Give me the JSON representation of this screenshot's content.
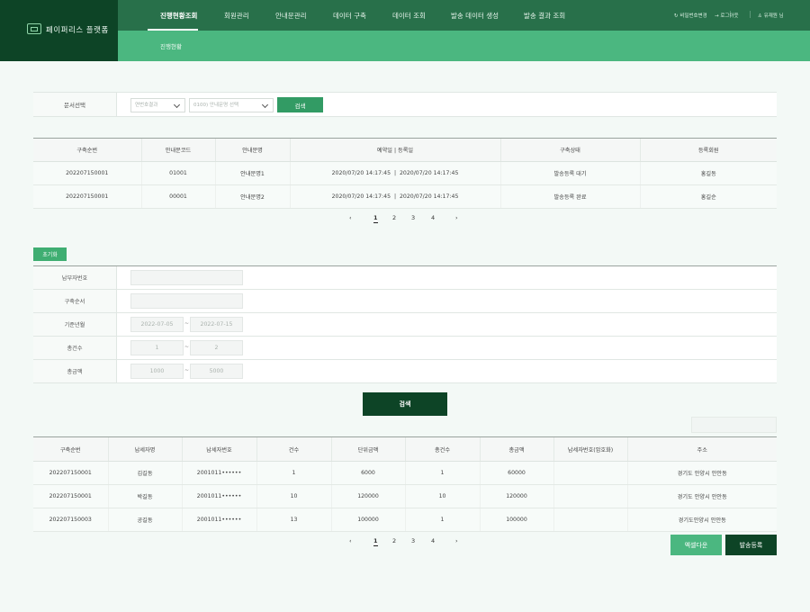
{
  "header": {
    "logo_text": "페이퍼리스 플랫폼",
    "nav": [
      "진행현황조회",
      "회원관리",
      "안내문관리",
      "데이터 구축",
      "데이터 조회",
      "발송 데이터 생성",
      "발송 결과 조회"
    ],
    "active_nav": "진행현황조회",
    "utils": {
      "password_change": "비밀번호변경",
      "logout": "로그아웃",
      "user": "유재원 님"
    },
    "subnav": "진행현황"
  },
  "filter": {
    "label": "문서선택",
    "select1_placeholder": "연번호결과",
    "select2_placeholder": "0100) 안내문명 선택",
    "search_label": "검색"
  },
  "table1": {
    "headers": [
      "구축순번",
      "안내문코드",
      "안내문명",
      "예약일 | 등록일",
      "구축상태",
      "등록회원"
    ],
    "rows": [
      [
        "202207150001",
        "01001",
        "안내문명1",
        "2020/07/20 14:17:45  |  2020/07/20 14:17:45",
        "발송등록 대기",
        "홍길동"
      ],
      [
        "202207150001",
        "00001",
        "안내문명2",
        "2020/07/20 14:17:45  |  2020/07/20 14:17:45",
        "발송등록 완료",
        "홍길순"
      ]
    ]
  },
  "pagination": {
    "prev": "‹",
    "next": "›",
    "pages": [
      "1",
      "2",
      "3",
      "4"
    ],
    "current": "1"
  },
  "search_form": {
    "reset_label": "초기화",
    "fields": [
      {
        "label": "납부자번호",
        "value": ""
      },
      {
        "label": "구축순서",
        "value": ""
      },
      {
        "label": "기준년월",
        "from": "2022-07-05",
        "to": "2022-07-15"
      },
      {
        "label": "총건수",
        "from": "1",
        "to": "2"
      },
      {
        "label": "총금액",
        "from": "1000",
        "to": "5000"
      }
    ],
    "range_sep": "~",
    "search_label": "검색"
  },
  "table2": {
    "headers": [
      "구축순번",
      "납세자명",
      "납세자번호",
      "건수",
      "단위금액",
      "총건수",
      "총금액",
      "납세자번호(암호화)",
      "주소"
    ],
    "rows": [
      [
        "202207150001",
        "김길동",
        "2001011••••••",
        "1",
        "6000",
        "1",
        "60000",
        "",
        "경기도 안양시 안안동"
      ],
      [
        "202207150001",
        "박길동",
        "2001011••••••",
        "10",
        "120000",
        "10",
        "120000",
        "",
        "경기도 안양시 안안동"
      ],
      [
        "202207150003",
        "공길동",
        "2001011••••••",
        "13",
        "100000",
        "1",
        "100000",
        "",
        "경기도안양시 안안동"
      ]
    ]
  },
  "actions": {
    "excel_label": "엑셀다운",
    "send_label": "발송등록"
  }
}
